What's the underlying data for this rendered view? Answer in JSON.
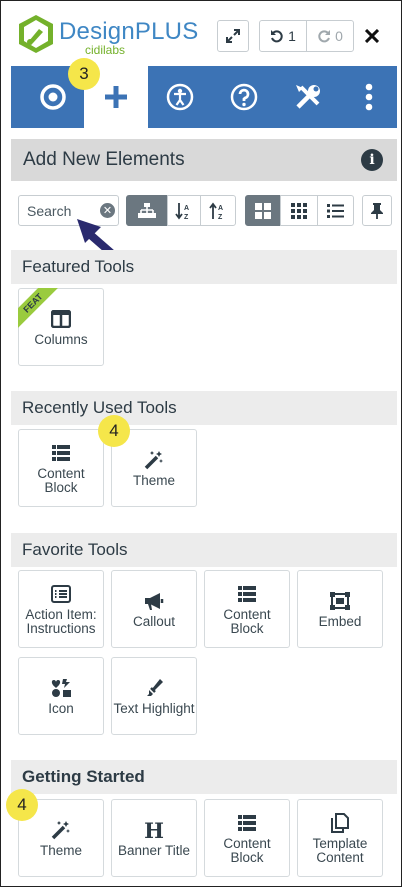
{
  "header": {
    "brand_title": "DesignPLUS",
    "brand_subtitle": "cidilabs",
    "undo_count": "1",
    "redo_count": "0"
  },
  "nav": {
    "tabs": [
      {
        "icon": "target-icon",
        "active": false
      },
      {
        "icon": "plus-icon",
        "active": true
      },
      {
        "icon": "accessibility-icon",
        "active": false
      },
      {
        "icon": "help-icon",
        "active": false
      },
      {
        "icon": "tools-icon",
        "active": false
      },
      {
        "icon": "more-vertical-icon",
        "active": false
      }
    ],
    "badge": "3"
  },
  "panel": {
    "title": "Add New Elements"
  },
  "toolbar": {
    "search_placeholder": "Search"
  },
  "sections": {
    "featured": {
      "title": "Featured Tools",
      "feat_label": "FEAT",
      "items": [
        {
          "label": "Columns",
          "icon": "columns-icon"
        }
      ]
    },
    "recent": {
      "title": "Recently Used Tools",
      "badge": "4",
      "items": [
        {
          "label": "Content Block",
          "icon": "content-block-icon"
        },
        {
          "label": "Theme",
          "icon": "magic-wand-icon"
        }
      ]
    },
    "favorite": {
      "title": "Favorite Tools",
      "items": [
        {
          "label": "Action Item: Instructions",
          "icon": "list-icon"
        },
        {
          "label": "Callout",
          "icon": "megaphone-icon"
        },
        {
          "label": "Content Block",
          "icon": "content-block-icon"
        },
        {
          "label": "Embed",
          "icon": "embed-icon"
        },
        {
          "label": "Icon",
          "icon": "icons-icon"
        },
        {
          "label": "Text Highlight",
          "icon": "highlighter-icon"
        }
      ]
    },
    "getting_started": {
      "title": "Getting Started",
      "badge": "4",
      "items": [
        {
          "label": "Theme",
          "icon": "magic-wand-icon"
        },
        {
          "label": "Banner Title",
          "icon": "heading-icon"
        },
        {
          "label": "Content Block",
          "icon": "content-block-icon"
        },
        {
          "label": "Template Content",
          "icon": "copy-icon"
        }
      ]
    }
  },
  "colors": {
    "nav_blue": "#3c73b5",
    "badge_yellow": "#f5e64a",
    "brand_green": "#74b12b",
    "brand_blue": "#3f87c4"
  }
}
